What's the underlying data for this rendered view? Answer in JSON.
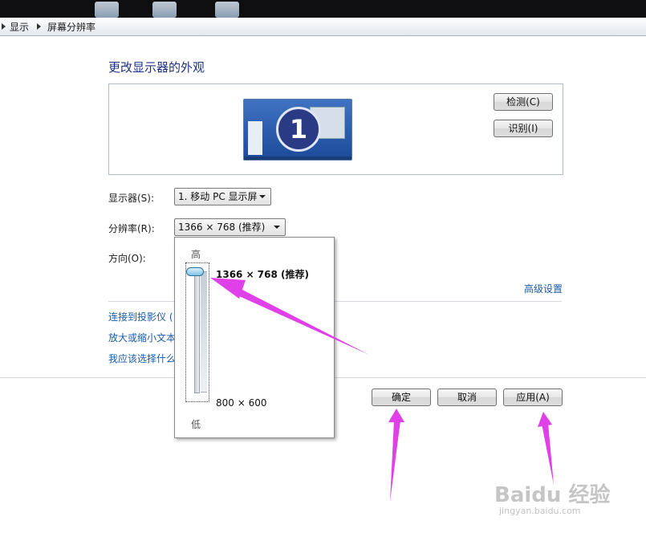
{
  "breadcrumb": {
    "items": [
      "显示",
      "屏幕分辨率"
    ]
  },
  "page_title": "更改显示器的外观",
  "buttons": {
    "detect": "检测(C)",
    "identify": "识别(I)",
    "ok": "确定",
    "cancel": "取消",
    "apply": "应用(A)"
  },
  "monitor": {
    "number": "1"
  },
  "fields": {
    "display": {
      "label": "显示器(S):",
      "value": "1. 移动 PC 显示屏"
    },
    "resolution": {
      "label": "分辨率(R):",
      "value": "1366 × 768 (推荐)"
    },
    "orientation": {
      "label": "方向(O):"
    }
  },
  "advanced_link": "高级设置",
  "links": [
    "连接到投影仪 (",
    "放大或缩小文本",
    "我应该选择什么"
  ],
  "resolution_popup": {
    "high_label": "高",
    "low_label": "低",
    "top_option": "1366 × 768 (推荐)",
    "bottom_option": "800 × 600",
    "slider_position": 1.0
  },
  "watermark": {
    "brand": "Baidu 经验",
    "url": "jingyan.baidu.com"
  },
  "colors": {
    "annotation_arrow": "#e040e8",
    "link": "#1a5ba8",
    "title": "#1e3287"
  }
}
